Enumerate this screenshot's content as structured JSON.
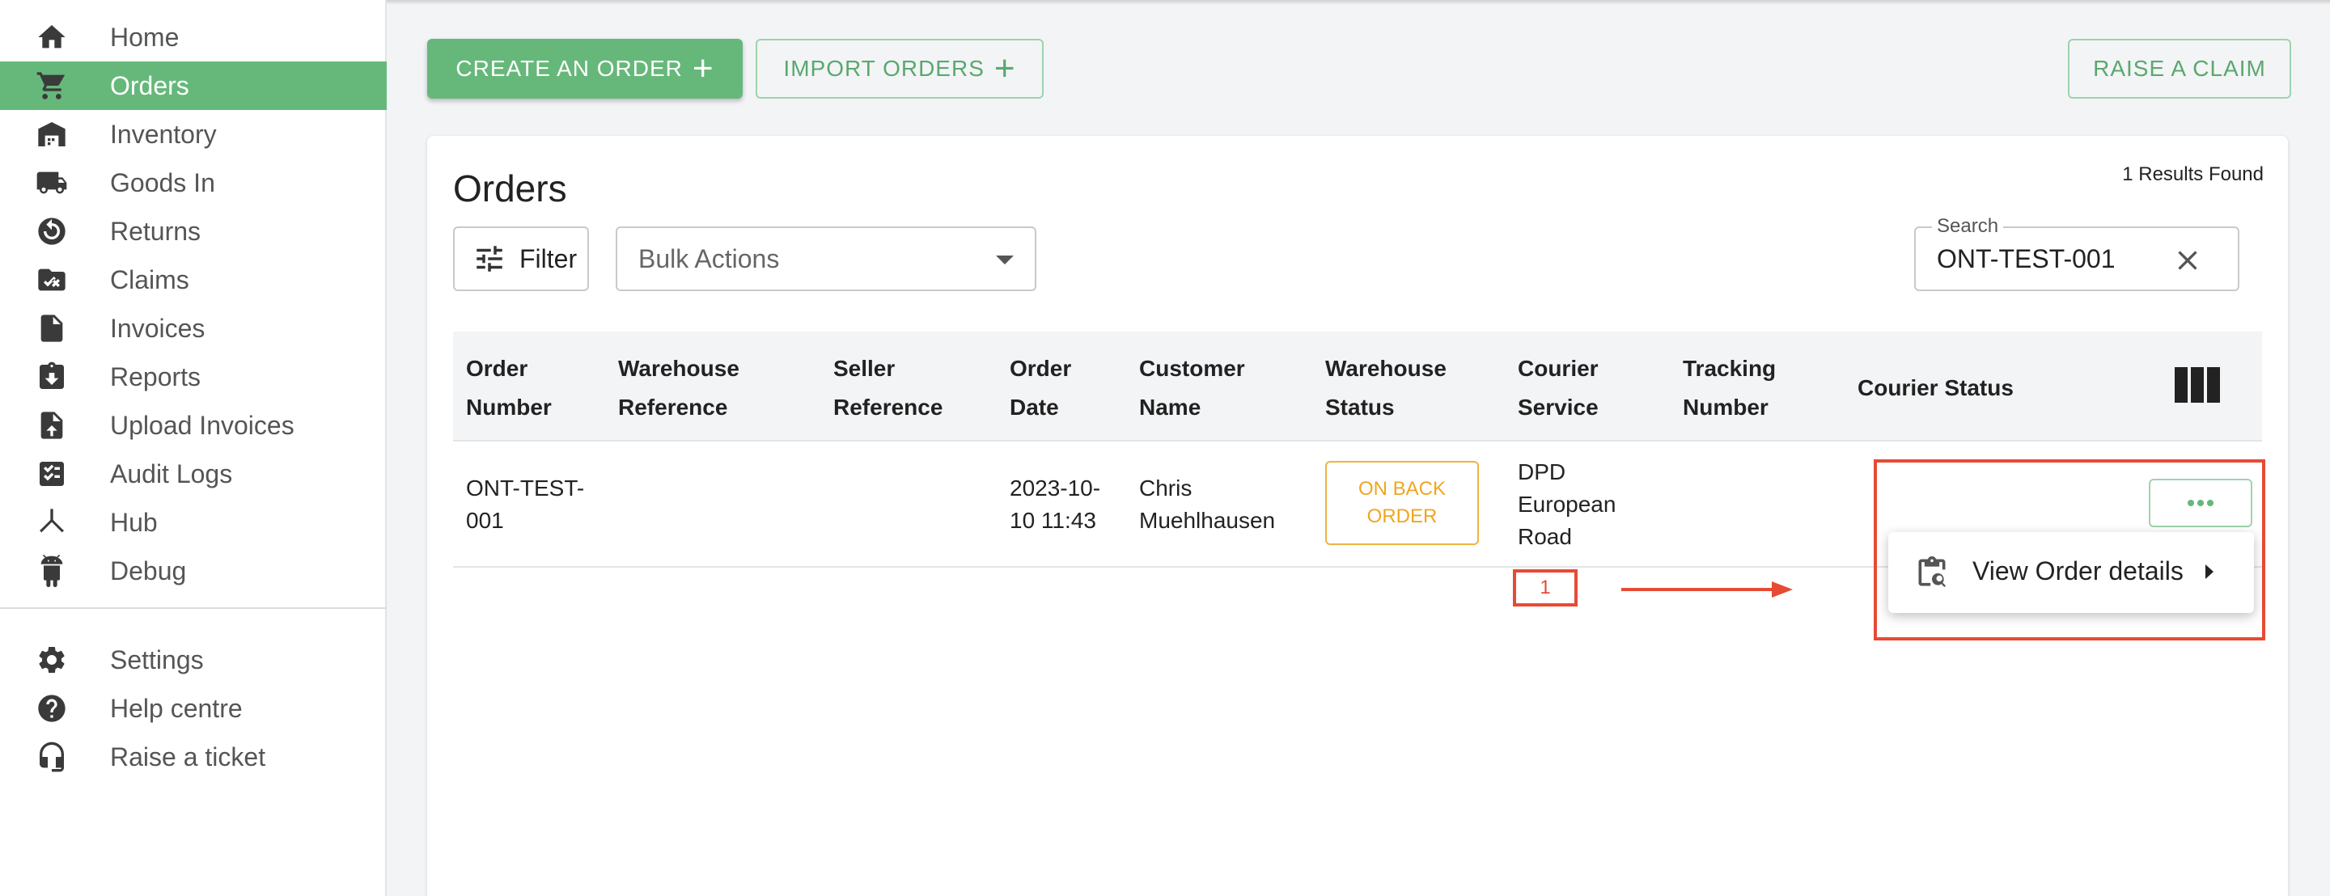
{
  "sidebar": {
    "items": [
      {
        "label": "Home",
        "icon": "home-icon"
      },
      {
        "label": "Orders",
        "icon": "cart-icon",
        "active": true
      },
      {
        "label": "Inventory",
        "icon": "warehouse-icon"
      },
      {
        "label": "Goods In",
        "icon": "truck-icon"
      },
      {
        "label": "Returns",
        "icon": "returns-icon"
      },
      {
        "label": "Claims",
        "icon": "folder-check-icon"
      },
      {
        "label": "Invoices",
        "icon": "file-icon"
      },
      {
        "label": "Reports",
        "icon": "clipboard-download-icon"
      },
      {
        "label": "Upload Invoices",
        "icon": "file-upload-icon"
      },
      {
        "label": "Audit Logs",
        "icon": "checklist-icon"
      },
      {
        "label": "Hub",
        "icon": "hub-icon"
      },
      {
        "label": "Debug",
        "icon": "android-icon"
      }
    ],
    "bottom_items": [
      {
        "label": "Settings",
        "icon": "gear-icon"
      },
      {
        "label": "Help centre",
        "icon": "help-icon"
      },
      {
        "label": "Raise a ticket",
        "icon": "headset-icon"
      }
    ]
  },
  "toolbar": {
    "create_label": "CREATE AN ORDER",
    "import_label": "IMPORT ORDERS",
    "claim_label": "RAISE A CLAIM"
  },
  "orders": {
    "title": "Orders",
    "results": "1 Results Found",
    "filter_label": "Filter",
    "bulk_label": "Bulk Actions",
    "search_label": "Search",
    "search_value": "ONT-TEST-001"
  },
  "table": {
    "headers": [
      [
        "Order",
        "Number"
      ],
      [
        "Warehouse",
        "Reference"
      ],
      [
        "Seller",
        "Reference"
      ],
      [
        "Order",
        "Date"
      ],
      [
        "Customer",
        "Name"
      ],
      [
        "Warehouse",
        "Status"
      ],
      [
        "Courier",
        "Service"
      ],
      [
        "Tracking",
        "Number"
      ],
      [
        "Courier Status"
      ]
    ],
    "row": {
      "order_number": [
        "ONT-TEST-",
        "001"
      ],
      "order_date": [
        "2023-10-",
        "10 11:43"
      ],
      "customer_name": [
        "Chris",
        "Muehlhausen"
      ],
      "warehouse_status": [
        "ON BACK",
        "ORDER"
      ],
      "courier_service": [
        "DPD",
        "European",
        "Road"
      ]
    }
  },
  "menu": {
    "view_label": "View Order details"
  },
  "annotation": {
    "number": "1",
    "color": "#e54b35"
  },
  "colors": {
    "accent": "#66b87a",
    "warning": "#f0a522"
  }
}
